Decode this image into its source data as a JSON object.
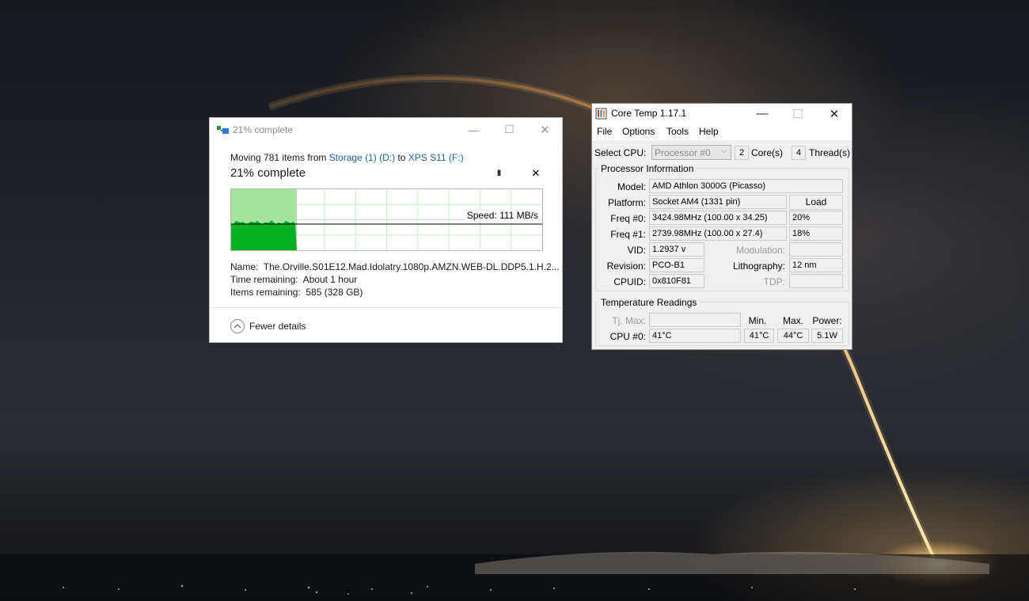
{
  "copy_dialog": {
    "title": "21% complete",
    "move_prefix": "Moving 781 items from ",
    "source": "Storage (1) (D:)",
    "to_word": " to ",
    "destination": "XPS S11 (F:)",
    "heading": "21% complete",
    "pause_label": "II",
    "cancel_label": "✕",
    "speed": "Speed: 111 MB/s",
    "progress_percent": 21,
    "name_label": "Name:",
    "name_value": "The.Orville.S01E12.Mad.Idolatry.1080p.AMZN.WEB-DL.DDP5.1.H.2...",
    "time_label": "Time remaining:",
    "time_value": "About 1 hour",
    "items_label": "Items remaining:",
    "items_value": "585 (328 GB)",
    "fewer_details": "Fewer details",
    "icons": [
      "copy-icon",
      "minimize-icon",
      "maximize-icon",
      "close-icon",
      "pause-icon",
      "cancel-icon",
      "chevron-up-icon"
    ]
  },
  "coretemp": {
    "title": "Core Temp 1.17.1",
    "menu": [
      "File",
      "Options",
      "Tools",
      "Help"
    ],
    "select_cpu_label": "Select CPU:",
    "select_cpu_value": "Processor #0",
    "cores_value": "2",
    "cores_label": "Core(s)",
    "threads_value": "4",
    "threads_label": "Thread(s)",
    "proc_info_title": "Processor Information",
    "model_label": "Model:",
    "model_value": "AMD Athlon 3000G (Picasso)",
    "platform_label": "Platform:",
    "platform_value": "Socket AM4 (1331 pin)",
    "load_label": "Load",
    "freq0_label": "Freq #0:",
    "freq0_value": "3424.98MHz (100.00 x 34.25)",
    "freq0_load": "20%",
    "freq1_label": "Freq #1:",
    "freq1_value": "2739.98MHz (100.00 x 27.4)",
    "freq1_load": "18%",
    "vid_label": "VID:",
    "vid_value": "1.2937 v",
    "modulation_label": "Modulation:",
    "modulation_value": "",
    "revision_label": "Revision:",
    "revision_value": "PCO-B1",
    "lithography_label": "Lithography:",
    "lithography_value": "12 nm",
    "cpuid_label": "CPUID:",
    "cpuid_value": "0x810F81",
    "tdp_label": "TDP:",
    "tdp_value": "",
    "temp_title": "Temperature Readings",
    "tjmax_label": "Tj. Max:",
    "tjmax_value": "",
    "min_header": "Min.",
    "max_header": "Max.",
    "power_header": "Power:",
    "cpu0_label": "CPU #0:",
    "cpu0_temp": "41°C",
    "cpu0_min": "41°C",
    "cpu0_max": "44°C",
    "cpu0_power": "5.1W"
  },
  "colors": {
    "graph_fill": "#06b025",
    "graph_light": "#a7e3a0",
    "link": "#1f5fa8"
  }
}
